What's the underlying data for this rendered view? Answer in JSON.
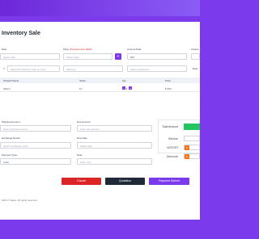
{
  "page": {
    "title": "Inventory Sale"
  },
  "form": {
    "date": {
      "label": "Date",
      "placeholder": "Select date"
    },
    "party": {
      "label": "Party",
      "hint": "(Previous due: $100)",
      "placeholder": "Select party"
    },
    "amount_paid": {
      "label": "Amount Paid",
      "value": "500"
    },
    "invoice": {
      "label": "Invoice"
    },
    "search": {
      "placeholder": "Search Product by code or name"
    },
    "sales_by": {
      "placeholder": "Sales by"
    },
    "warehouse": {
      "placeholder": "Select warehouse"
    },
    "cutoff_button": "Retu"
  },
  "table": {
    "headers": [
      "Product Name",
      "Stock",
      "Qty",
      "Price"
    ],
    "row": {
      "name": "Watch",
      "stock": "10",
      "qty": "1",
      "price": "$ 500"
    }
  },
  "bottom": {
    "shipping": {
      "label": "Shipping Amount",
      "placeholder": "Enter received amount"
    },
    "due": {
      "label": "Due Amount",
      "placeholder": "Enter due amount"
    },
    "exchange": {
      "label": "Exchange Return",
      "placeholder": "Select exchange return"
    },
    "due_date": {
      "label": "Due Date",
      "placeholder": "Select date"
    },
    "payment_type": {
      "label": "Payment Type",
      "value": "Cash"
    },
    "note": {
      "label": "Note",
      "placeholder": "Enter note"
    }
  },
  "summary": {
    "total_label": "Total Amount",
    "service_label": "Service",
    "vat_label": "VAT/GST",
    "discount_label": "Discount"
  },
  "buttons": {
    "cancel": "Cancel",
    "quotation": "Quotation",
    "payment": "Payment Submit"
  },
  "footer": "2023 © Sales. All rights reserved.",
  "colors": {
    "accent": "#7c3aed",
    "cancel": "#dc2626",
    "quotation": "#1f2937",
    "total": "#22c55e",
    "action": "#f97316"
  }
}
